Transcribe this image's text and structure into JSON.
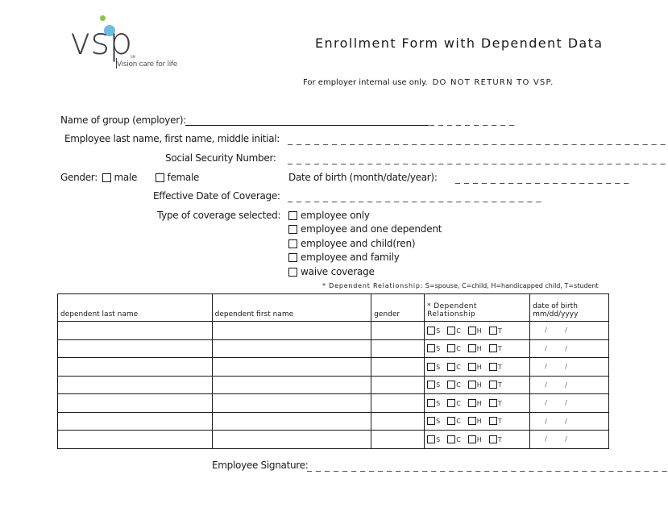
{
  "logo": {
    "wordmark": "vsp",
    "service_mark": "SM",
    "tagline": "Vision care for life",
    "colors": {
      "text": "#3d3f44",
      "green_dot": "#8cc63f",
      "blue_dot": "#6cbbe4"
    }
  },
  "header": {
    "title": "Enrollment Form with Dependent Data",
    "notice_prefix": "For employer internal use only.",
    "notice_caps": "DO NOT RETURN TO VSP."
  },
  "fields": {
    "group_name": {
      "label": "Name of group (employer):",
      "value": "",
      "dash_tail": "_ _ _ _ _ _ _ _ _ _"
    },
    "employee_name": {
      "label": "Employee last name, first name, middle initial:",
      "value": "",
      "dashes": "_ _ _ _ _ _ _ _ _ _ _ _ _ _ _ _ _ _ _ _ _ _ _ _ _ _ _ _ _ _ _ _ _ _ _ _ _ _ _ _ _ _ _ _ _ _ _ _ _ _"
    },
    "ssn": {
      "label": "Social Security Number:",
      "value": "",
      "dashes": "_ _ _ _ _ _ _ _ _ _ _ _ _ _ _ _ _ _ _ _ _ _ _ _ _ _ _ _ _ _ _ _ _ _ _ _ _ _ _ _ _ _ _ _ _ _ _ _ _ _"
    },
    "gender": {
      "label": "Gender:",
      "options": [
        "male",
        "female"
      ],
      "selected": null
    },
    "dob": {
      "label": "Date of birth (month/date/year):",
      "value": "",
      "dashes": "_ _ _ _ _ _ _ _ _ _ _ _ _ _ _ _ _ _ _ _"
    },
    "effective_date": {
      "label": "Effective Date of Coverage:",
      "value": "",
      "dashes": "_ _ _ _ _ _ _ _ _ _ _ _ _ _ _ _ _ _ _ _ _ _ _ _ _ _ _ _ _"
    },
    "coverage": {
      "label": "Type of coverage selected:",
      "options": [
        "employee only",
        "employee and one dependent",
        "employee and child(ren)",
        "employee and family",
        "waive coverage"
      ],
      "selected": null
    }
  },
  "relationship_note": {
    "prefix": "* Dependent Relationship:",
    "text": "S=spouse, C=child, H=handicapped child, T=student"
  },
  "dependents_table": {
    "columns": [
      "dependent last name",
      "dependent first name",
      "gender",
      "* Dependent Relationship",
      "date of birth mm/dd/yyyy"
    ],
    "dob_header_line1": "date of birth",
    "dob_header_line2": "mm/dd/yyyy",
    "relationship_codes": [
      "S",
      "C",
      "H",
      "T"
    ],
    "date_separator": "/",
    "rows": [
      {
        "last_name": "",
        "first_name": "",
        "gender": "",
        "relationship": null,
        "dob": ""
      },
      {
        "last_name": "",
        "first_name": "",
        "gender": "",
        "relationship": null,
        "dob": ""
      },
      {
        "last_name": "",
        "first_name": "",
        "gender": "",
        "relationship": null,
        "dob": ""
      },
      {
        "last_name": "",
        "first_name": "",
        "gender": "",
        "relationship": null,
        "dob": ""
      },
      {
        "last_name": "",
        "first_name": "",
        "gender": "",
        "relationship": null,
        "dob": ""
      },
      {
        "last_name": "",
        "first_name": "",
        "gender": "",
        "relationship": null,
        "dob": ""
      },
      {
        "last_name": "",
        "first_name": "",
        "gender": "",
        "relationship": null,
        "dob": ""
      }
    ]
  },
  "signature": {
    "label": "Employee Signature:",
    "dashes": "_ _ _ _ _ _ _ _ _ _ _ _ _ _ _ _ _ _ _ _ _ _ _ _ _ _ _ _ _ _ _ _ _ _ _ _ _ _ _ _ _ _ _ _ _ _ _ _ _ _ _ _ _ _ _ _"
  }
}
